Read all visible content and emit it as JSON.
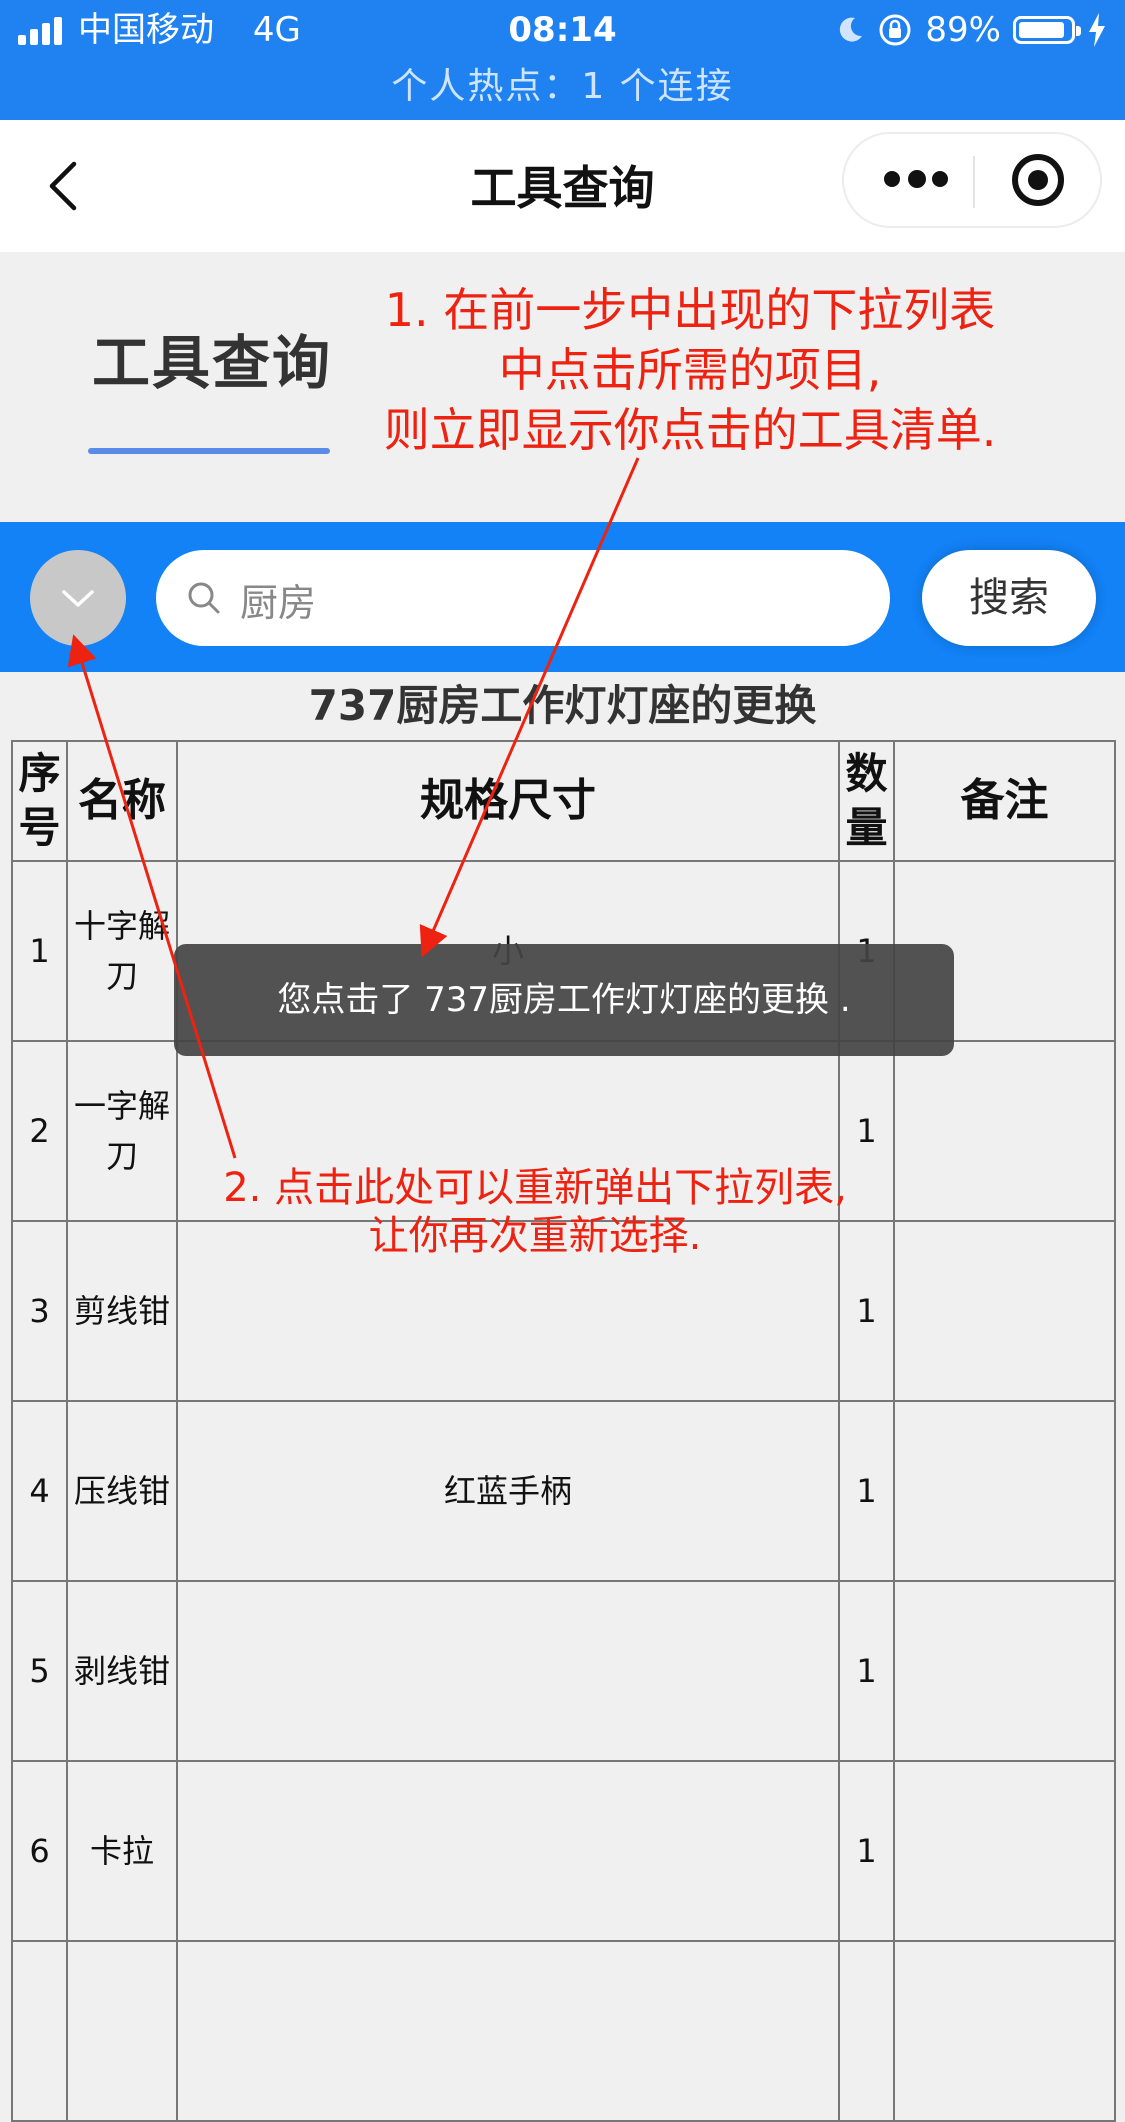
{
  "status_bar": {
    "carrier": "中国移动",
    "network": "4G",
    "time": "08:14",
    "battery": "89%",
    "battery_level": 0.89,
    "hotspot": "个人热点：1 个连接"
  },
  "nav": {
    "title": "工具查询"
  },
  "header": {
    "title": "工具查询"
  },
  "search": {
    "value": "厨房",
    "button_label": "搜索"
  },
  "table": {
    "title": "737厨房工作灯灯座的更换",
    "headers": [
      "序号",
      "名称",
      "规格尺寸",
      "数量",
      "备注"
    ],
    "rows": [
      {
        "no": "1",
        "name": "十字解刀",
        "spec": "小",
        "qty": "1",
        "note": ""
      },
      {
        "no": "2",
        "name": "一字解刀",
        "spec": "",
        "qty": "1",
        "note": ""
      },
      {
        "no": "3",
        "name": "剪线钳",
        "spec": "",
        "qty": "1",
        "note": ""
      },
      {
        "no": "4",
        "name": "压线钳",
        "spec": "红蓝手柄",
        "qty": "1",
        "note": ""
      },
      {
        "no": "5",
        "name": "剥线钳",
        "spec": "",
        "qty": "1",
        "note": ""
      },
      {
        "no": "6",
        "name": "卡拉",
        "spec": "",
        "qty": "1",
        "note": ""
      },
      {
        "no": "",
        "name": "",
        "spec": "",
        "qty": "",
        "note": ""
      }
    ]
  },
  "toast": {
    "message": "您点击了 737厨房工作灯灯座的更换 ."
  },
  "annotations": {
    "note1_line1": "1. 在前一步中出现的下拉列表",
    "note1_line2": "中点击所需的项目,",
    "note1_line3": "则立即显示你点击的工具清单.",
    "note2_line1": "2. 点击此处可以重新弹出下拉列表,",
    "note2_line2": "让你再次重新选择.",
    "color": "#ee2211"
  },
  "colors": {
    "accent": "#1282f6",
    "status_bar": "#1f82f0"
  }
}
